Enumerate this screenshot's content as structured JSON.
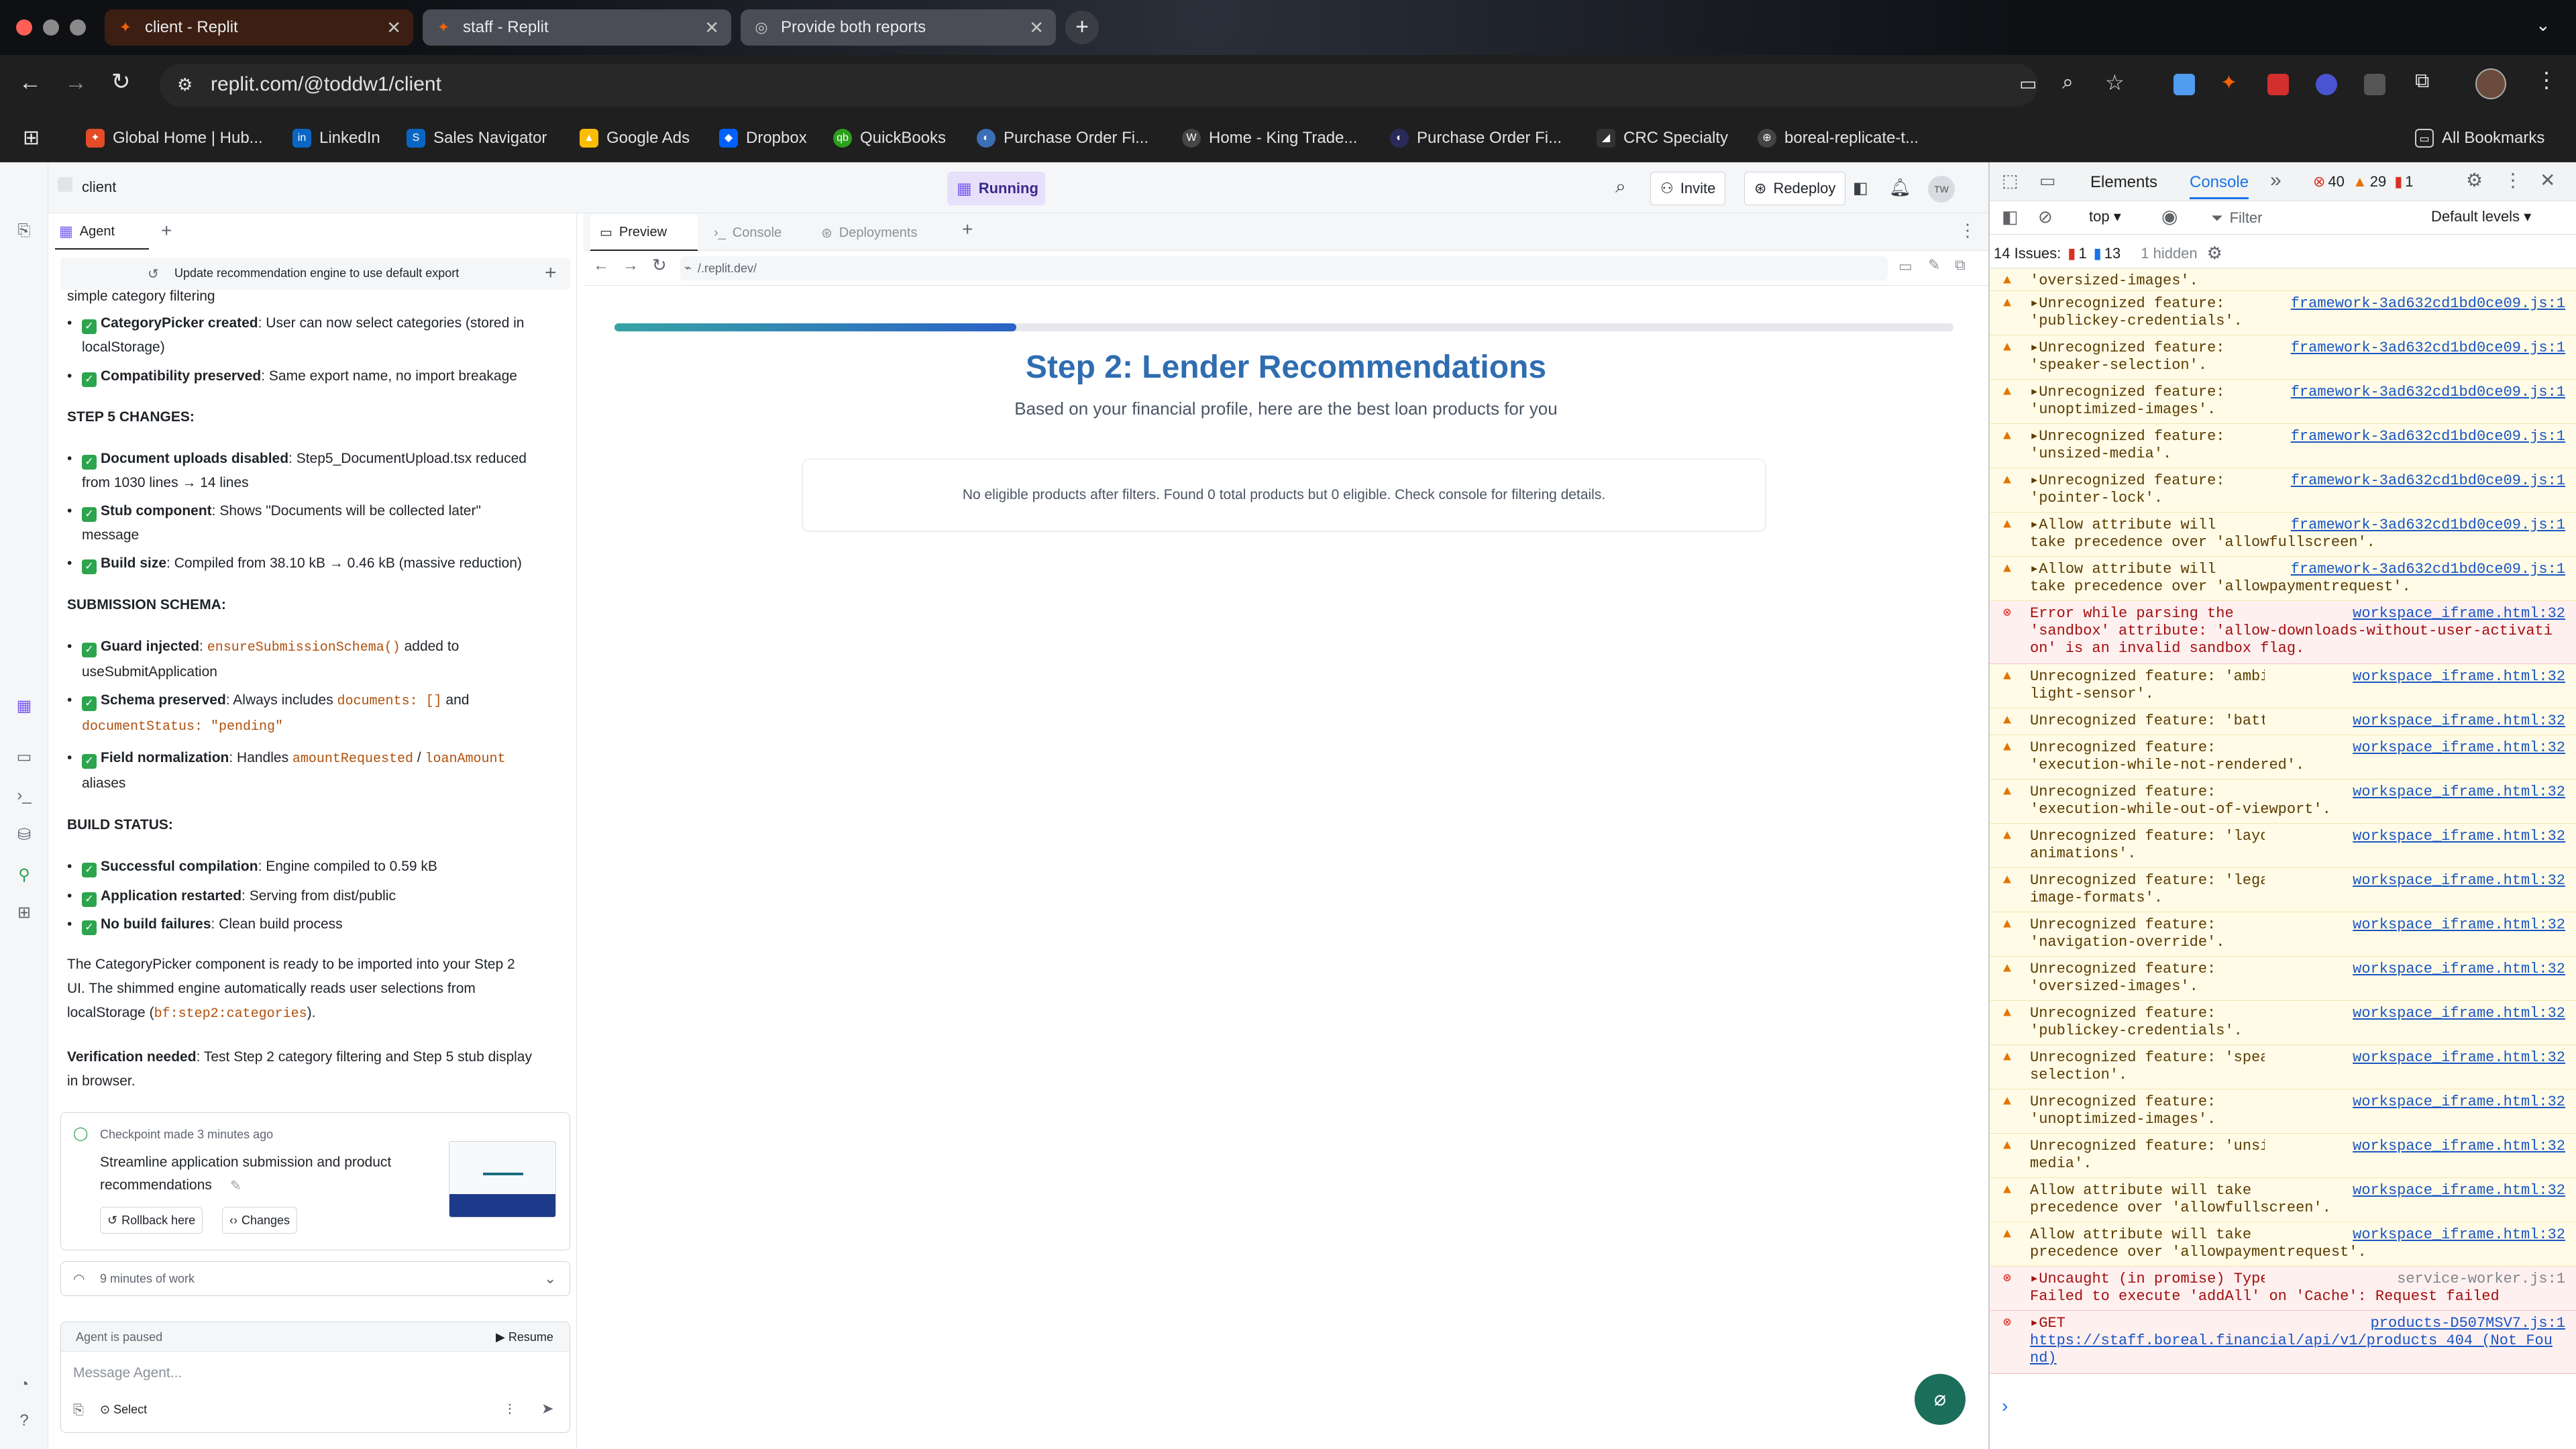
{
  "browser": {
    "tabs": [
      {
        "label": "client - Replit",
        "active": true
      },
      {
        "label": "staff - Replit",
        "active": false
      },
      {
        "label": "Provide both reports",
        "active": false
      }
    ],
    "new_tab": "+",
    "url": "replit.com/@toddw1/client",
    "bookmarks": [
      "Global Home | Hub...",
      "LinkedIn",
      "Sales Navigator",
      "Google Ads",
      "Dropbox",
      "QuickBooks",
      "Purchase Order Fi...",
      "Home - King Trade...",
      "Purchase Order Fi...",
      "CRC Specialty",
      "boreal-replicate-t..."
    ],
    "all_bookmarks": "All Bookmarks"
  },
  "replit": {
    "repl_name": "client",
    "status": "Running",
    "invite": "Invite",
    "redeploy": "Redeploy",
    "avatar": "TW"
  },
  "agent": {
    "tab_label": "Agent",
    "thread_title": "Update recommendation engine to use default export",
    "lines": {
      "l0": "simple category filtering",
      "cp_bold": "CategoryPicker created",
      "cp_text": ": User can now select categories (stored in",
      "cp_text2": "localStorage)",
      "compat_bold": "Compatibility preserved",
      "compat_text": ": Same export name, no import breakage",
      "step5": "STEP 5 CHANGES:",
      "doc_bold": "Document uploads disabled",
      "doc_text": ": Step5_DocumentUpload.tsx reduced",
      "doc_text2": "from 1030 lines → 14 lines",
      "stub_bold": "Stub component",
      "stub_text": ": Shows \"Documents will be collected later\"",
      "stub_text2": "message",
      "build_bold": "Build size",
      "build_text": ": Compiled from 38.10 kB → 0.46 kB (massive reduction)",
      "schema": "SUBMISSION SCHEMA:",
      "guard_bold": "Guard injected",
      "guard_code": "ensureSubmissionSchema()",
      "guard_text": "added to",
      "guard_text2": "useSubmitApplication",
      "sp_bold": "Schema preserved",
      "sp_text": ": Always includes",
      "sp_code1": "documents: []",
      "sp_and": "and",
      "sp_code2": "documentStatus: \"pending\"",
      "fn_bold": "Field normalization",
      "fn_text": ": Handles",
      "fn_code1": "amountRequested",
      "fn_slash": "/",
      "fn_code2": "loanAmount",
      "fn_text2": "aliases",
      "buildstatus": "BUILD STATUS:",
      "sc_bold": "Successful compilation",
      "sc_text": ": Engine compiled to 0.59 kB",
      "ar_bold": "Application restarted",
      "ar_text": ": Serving from dist/public",
      "nb_bold": "No build failures",
      "nb_text": ": Clean build process",
      "para1a": "The CategoryPicker component is ready to be imported into your Step 2",
      "para1b": "UI. The shimmed engine automatically reads user selections from",
      "para1c": "localStorage (",
      "para1code": "bf:step2:categories",
      "para1d": ").",
      "verify_bold": "Verification needed",
      "verify_text": ": Test Step 2 category filtering and Step 5 stub display",
      "verify_text2": "in browser."
    },
    "checkpoint": {
      "meta": "Checkpoint made 3 minutes ago",
      "title1": "Streamline application submission and product",
      "title2": "recommendations",
      "rollback": "Rollback here",
      "changes": "Changes"
    },
    "work": "9 minutes of work",
    "paused": "Agent is paused",
    "resume": "Resume",
    "input_placeholder": "Message Agent...",
    "select": "Select"
  },
  "preview": {
    "tabs": [
      "Preview",
      "Console",
      "Deployments"
    ],
    "url": "/.replit.dev/",
    "progress": 0.3,
    "heading": "Step 2: Lender Recommendations",
    "subheading": "Based on your financial profile, here are the best loan products for you",
    "notice": "No eligible products after filters. Found 0 total products but 0 eligible. Check console for filtering details."
  },
  "devtools": {
    "tabs": [
      "Elements",
      "Console"
    ],
    "more": "»",
    "errors": "40",
    "warnings": "29",
    "infos": "1",
    "context": "top",
    "filter_placeholder": "Filter",
    "levels": "Default levels",
    "issues_label": "14 Issues:",
    "issues_err": "1",
    "issues_info": "13",
    "hidden": "1 hidden",
    "rows": [
      {
        "type": "warn",
        "l1": "'oversized-images'.",
        "l2": "",
        "src": "",
        "h": 34
      },
      {
        "type": "warn",
        "l1": "▸Unrecognized feature:",
        "l2": "'publickey-credentials'.",
        "src": "framework-3ad632cd1bd0ce09.js:1",
        "h": 66
      },
      {
        "type": "warn",
        "l1": "▸Unrecognized feature:",
        "l2": "'speaker-selection'.",
        "src": "framework-3ad632cd1bd0ce09.js:1",
        "h": 66
      },
      {
        "type": "warn",
        "l1": "▸Unrecognized feature:",
        "l2": "'unoptimized-images'.",
        "src": "framework-3ad632cd1bd0ce09.js:1",
        "h": 66
      },
      {
        "type": "warn",
        "l1": "▸Unrecognized feature:",
        "l2": "'unsized-media'.",
        "src": "framework-3ad632cd1bd0ce09.js:1",
        "h": 66
      },
      {
        "type": "warn",
        "l1": "▸Unrecognized feature:",
        "l2": "'pointer-lock'.",
        "src": "framework-3ad632cd1bd0ce09.js:1",
        "h": 66
      },
      {
        "type": "warn",
        "l1": "▸Allow attribute will",
        "l2": "take precedence over 'allowfullscreen'.",
        "src": "framework-3ad632cd1bd0ce09.js:1",
        "h": 66
      },
      {
        "type": "warn",
        "l1": "▸Allow attribute will",
        "l2": "take precedence over 'allowpaymentrequest'.",
        "src": "framework-3ad632cd1bd0ce09.js:1",
        "h": 66
      },
      {
        "type": "err",
        "l1": "Error while parsing the",
        "l2": "'sandbox' attribute: 'allow-downloads-without-user-activation' is an invalid sandbox flag.",
        "src": "workspace_iframe.html:32",
        "h": 94
      },
      {
        "type": "warn",
        "l1": "Unrecognized feature: 'ambient-",
        "l2": "light-sensor'.",
        "src": "workspace_iframe.html:32",
        "h": 66
      },
      {
        "type": "warn",
        "l1": "Unrecognized feature: 'battery'.",
        "l2": "",
        "src": "workspace_iframe.html:32",
        "h": 40
      },
      {
        "type": "warn",
        "l1": "Unrecognized feature:",
        "l2": "'execution-while-not-rendered'.",
        "src": "workspace_iframe.html:32",
        "h": 66
      },
      {
        "type": "warn",
        "l1": "Unrecognized feature:",
        "l2": "'execution-while-out-of-viewport'.",
        "src": "workspace_iframe.html:32",
        "h": 66
      },
      {
        "type": "warn",
        "l1": "Unrecognized feature: 'layout-",
        "l2": "animations'.",
        "src": "workspace_iframe.html:32",
        "h": 66
      },
      {
        "type": "warn",
        "l1": "Unrecognized feature: 'legacy-",
        "l2": "image-formats'.",
        "src": "workspace_iframe.html:32",
        "h": 66
      },
      {
        "type": "warn",
        "l1": "Unrecognized feature:",
        "l2": "'navigation-override'.",
        "src": "workspace_iframe.html:32",
        "h": 66
      },
      {
        "type": "warn",
        "l1": "Unrecognized feature:",
        "l2": "'oversized-images'.",
        "src": "workspace_iframe.html:32",
        "h": 66
      },
      {
        "type": "warn",
        "l1": "Unrecognized feature:",
        "l2": "'publickey-credentials'.",
        "src": "workspace_iframe.html:32",
        "h": 66
      },
      {
        "type": "warn",
        "l1": "Unrecognized feature: 'speaker-",
        "l2": "selection'.",
        "src": "workspace_iframe.html:32",
        "h": 66
      },
      {
        "type": "warn",
        "l1": "Unrecognized feature:",
        "l2": "'unoptimized-images'.",
        "src": "workspace_iframe.html:32",
        "h": 66
      },
      {
        "type": "warn",
        "l1": "Unrecognized feature: 'unsized-",
        "l2": "media'.",
        "src": "workspace_iframe.html:32",
        "h": 66
      },
      {
        "type": "warn",
        "l1": "Allow attribute will take",
        "l2": "precedence over 'allowfullscreen'.",
        "src": "workspace_iframe.html:32",
        "h": 66
      },
      {
        "type": "warn",
        "l1": "Allow attribute will take",
        "l2": "precedence over 'allowpaymentrequest'.",
        "src": "workspace_iframe.html:32",
        "h": 66
      },
      {
        "type": "err",
        "l1": "▸Uncaught (in promise) TypeError:",
        "l2": "Failed to execute 'addAll' on 'Cache': Request failed",
        "src": "service-worker.js:1",
        "h": 66
      },
      {
        "type": "err",
        "l1": "▸GET",
        "l2": "https://staff.boreal.financial/api/v1/products 404 (Not Found)",
        "src": "products-D507MSV7.js:1",
        "h": 94
      }
    ],
    "prompt": "›"
  }
}
